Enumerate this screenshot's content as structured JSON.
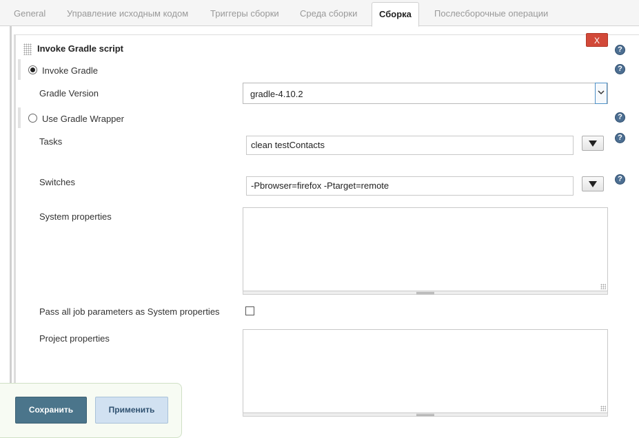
{
  "tabs": [
    {
      "label": "General",
      "active": false
    },
    {
      "label": "Управление исходным кодом",
      "active": false
    },
    {
      "label": "Триггеры сборки",
      "active": false
    },
    {
      "label": "Среда сборки",
      "active": false
    },
    {
      "label": "Сборка",
      "active": true
    },
    {
      "label": "Послесборочные операции",
      "active": false
    }
  ],
  "section": {
    "title": "Invoke Gradle script",
    "delete_label": "X",
    "help_glyph": "?"
  },
  "invoke_gradle": {
    "label": "Invoke Gradle",
    "selected": true,
    "version_label": "Gradle Version",
    "version_value": "gradle-4.10.2"
  },
  "wrapper": {
    "label": "Use Gradle Wrapper",
    "selected": false
  },
  "tasks": {
    "label": "Tasks",
    "value": "clean testContacts"
  },
  "switches": {
    "label": "Switches",
    "value": "-Pbrowser=firefox -Ptarget=remote"
  },
  "system_properties": {
    "label": "System properties",
    "value": ""
  },
  "pass_params": {
    "label": "Pass all job parameters as System properties",
    "checked": false
  },
  "project_properties": {
    "label": "Project properties",
    "value": ""
  },
  "buttons": {
    "save": "Сохранить",
    "apply": "Применить"
  },
  "colors": {
    "delete": "#d24939",
    "help": "#4d6f92",
    "save": "#4b758b",
    "apply": "#d1e1f1"
  },
  "icons": [
    "drag-handle-icon",
    "help-icon",
    "chevron-down-icon",
    "triangle-down-icon",
    "resize-grip-icon"
  ]
}
